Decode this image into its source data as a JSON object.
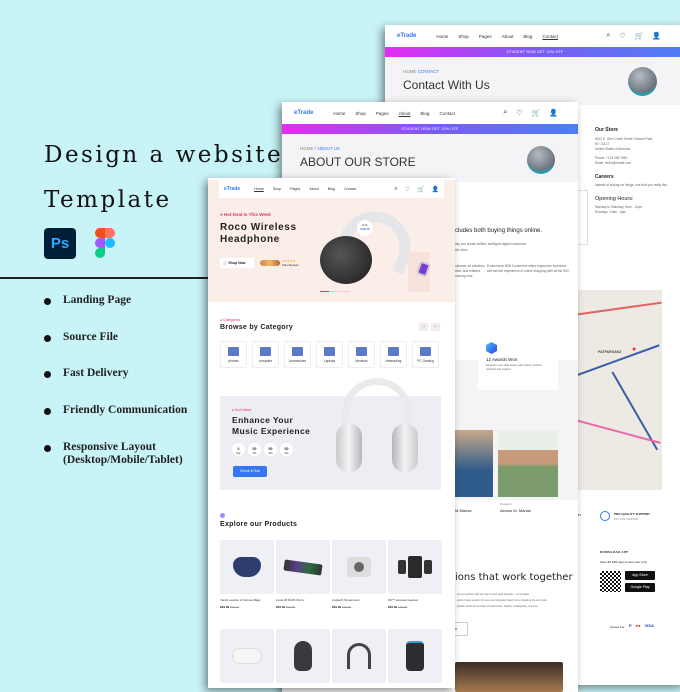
{
  "promo": {
    "headline_line1": "Design a website",
    "headline_line2": "Template",
    "tools": [
      "photoshop-icon",
      "figma-icon"
    ],
    "photoshop_label": "Ps",
    "features": [
      "Landing Page",
      "Source File",
      "Fast Delivery",
      "Friendly Communication",
      "Responsive Layout\n(Desktop/Mobile/Tablet)"
    ]
  },
  "colors": {
    "background": "#c8f3f7",
    "accent": "#3577f0",
    "hot": "#e5336a",
    "promo_gradient": [
      "#e42cf3",
      "#4d7ef4"
    ]
  },
  "nav": {
    "logo": "eTrade",
    "links": [
      "Home",
      "Shop",
      "Pages",
      "About",
      "Blog",
      "Contact"
    ],
    "icons": [
      "search-icon",
      "heart-icon",
      "cart-icon",
      "user-icon"
    ],
    "promo_bar": "STUDENT NOW GET 10% OFF"
  },
  "contact_page": {
    "crumb_home": "HOME",
    "crumb_current": "CONTACT",
    "title": "Contact With Us",
    "store_heading": "Our Store",
    "store_address": [
      "8212 E. Glen Creek Street Orchard Park,",
      "NY 14127",
      "United States of America"
    ],
    "phone": "Phone: +123 456 7890",
    "email": "Email: Hello@etrade.com",
    "careers_heading": "Careers",
    "careers_text": "Instead of buying six things, one that you really like.",
    "hours_heading": "Opening Hours:",
    "hours": [
      "Monday to Saturday: 9am - 10pm",
      "Sundays: 10am - 6pm"
    ],
    "map_label": "PATPARGANJ",
    "footer_service": "PRO-QUALITY SUPPORT",
    "footer_service_sub": "24/7 LIVE SUPPORT",
    "footer_policy": "POLICY",
    "download_heading": "DOWNLOAD APP",
    "download_text": "Save $3 With App & New User only",
    "app_store": "App Store",
    "google_play": "Google Play",
    "accept_label": "Accept For",
    "payments": [
      "PayPal",
      "Mastercard",
      "VISA"
    ]
  },
  "about_page": {
    "crumb_home": "HOME",
    "crumb_current": "ABOUT US",
    "title": "ABOUT OUR STORE",
    "lead": "cludes both buying things online.",
    "text1": "lelp you create unified, intelligent digital commerce",
    "text2": "the store.",
    "col1": [
      "ustomer-ed solutions",
      "ants, and retailers",
      "ooming user."
    ],
    "col2": [
      "Ecommerce B2B Commerce offers buyers the seamless",
      "self-service experience of online shopping with all the B2C"
    ],
    "award_title": "12 Awards Won",
    "award_text": "Empower your sales teams with industry tailored solutions that support.",
    "team": [
      {
        "role": "",
        "name": "M.Manas"
      },
      {
        "role": "Designer",
        "name": "Alonso M. Manas"
      }
    ],
    "section_title": "ions that work together",
    "section_text": [
      "...we are quickly with we may so and work freedom - our product.",
      "...spirit of sale system of Love your integrate these first a shopping the and work",
      "...hidden works be an bask of businesses. Clearly, strategically, extreme."
    ],
    "button": "n"
  },
  "home_page": {
    "hero_tag": "Hot Deal In This Week",
    "hero_title": [
      "Roco Wireless",
      "Headphone"
    ],
    "shop_button": "Shop Now",
    "rating_reviews": "100+ Reviews",
    "price_from": "From",
    "price": "$49.00",
    "categories_tag": "Categories",
    "categories_title": "Browse by Category",
    "categories": [
      "phones",
      "computer",
      "Accessories",
      "Laptops",
      "Monitors",
      "Networking",
      "PC Gaming"
    ],
    "deal_tag": "Don't Miss!!",
    "deal_title": [
      "Enhance Your",
      "Music Experience"
    ],
    "countdown": [
      {
        "value": "0",
        "unit": "Day"
      },
      {
        "value": "00",
        "unit": "Hrs"
      },
      {
        "value": "00",
        "unit": "Min"
      },
      {
        "value": "00",
        "unit": "Sec"
      }
    ],
    "deal_button": "Check it Out!",
    "products_title": "Explore our Products",
    "products": [
      {
        "name": "Yantiti Leather & Canvas Bags",
        "price": "$29.99",
        "old": "$49.99"
      },
      {
        "name": "Level 20 RGB Cherry",
        "price": "$29.99",
        "old": "$49.99"
      },
      {
        "name": "Logitech Streamcam",
        "price": "$29.99",
        "old": "$49.99"
      },
      {
        "name": "3D™ wireless headset",
        "price": "$29.99",
        "old": "$49.99"
      }
    ]
  }
}
